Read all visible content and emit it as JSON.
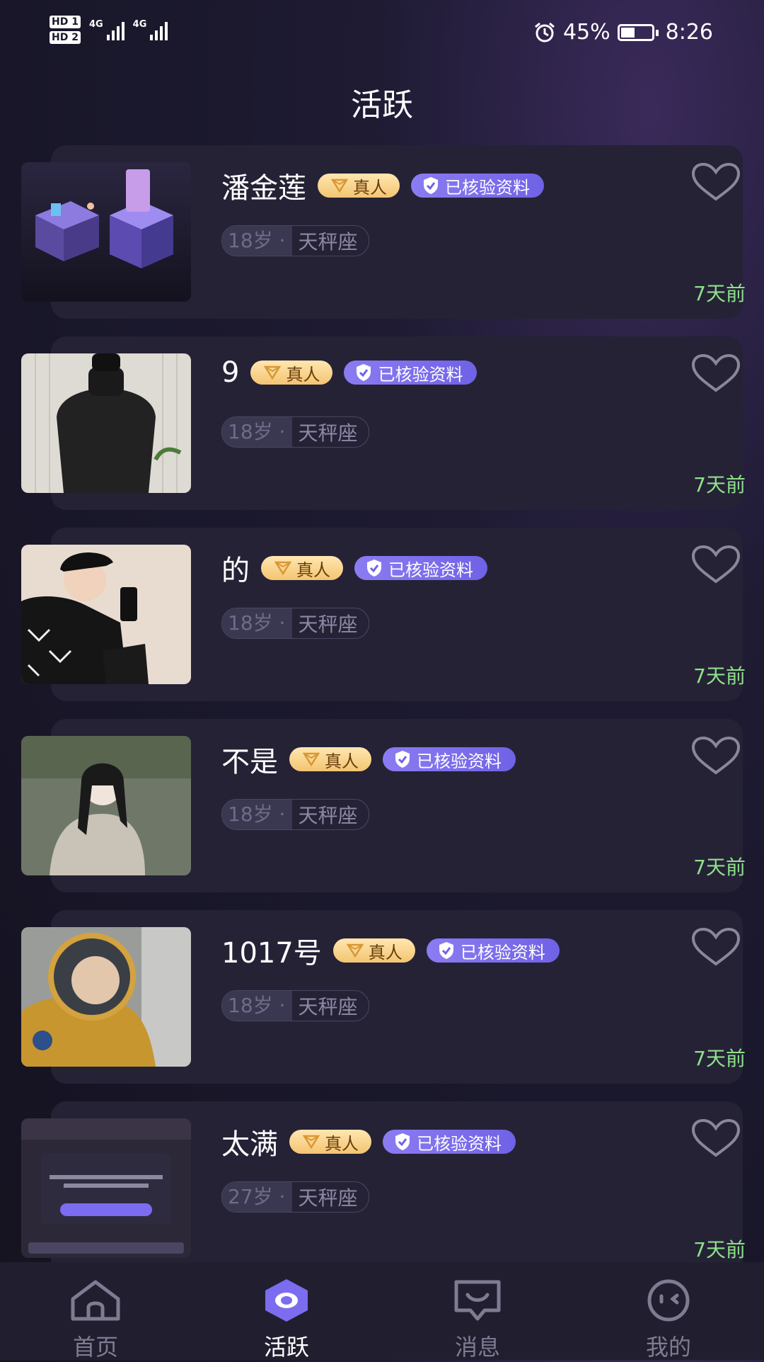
{
  "status_bar": {
    "sim1": "HD 1",
    "sim2": "HD 2",
    "network1": "4G",
    "network2": "4G",
    "battery": "45%",
    "battery_level": 0.45,
    "time": "8:26"
  },
  "page": {
    "title": "活跃"
  },
  "badges": {
    "real": "真人",
    "verified": "已核验资料"
  },
  "users": [
    {
      "name": "潘金莲",
      "age": "18岁 ·",
      "zodiac": "天秤座",
      "time": "7天前"
    },
    {
      "name": "9",
      "age": "18岁 ·",
      "zodiac": "天秤座",
      "time": "7天前"
    },
    {
      "name": "的",
      "age": "18岁 ·",
      "zodiac": "天秤座",
      "time": "7天前"
    },
    {
      "name": "不是",
      "age": "18岁 ·",
      "zodiac": "天秤座",
      "time": "7天前"
    },
    {
      "name": "1017号",
      "age": "18岁 ·",
      "zodiac": "天秤座",
      "time": "7天前"
    },
    {
      "name": "太满",
      "age": "27岁 ·",
      "zodiac": "天秤座",
      "time": "7天前"
    }
  ],
  "tabs": [
    {
      "label": "首页",
      "icon": "home-icon"
    },
    {
      "label": "活跃",
      "icon": "active-eye-icon",
      "active": true
    },
    {
      "label": "消息",
      "icon": "message-icon"
    },
    {
      "label": "我的",
      "icon": "profile-face-icon"
    }
  ],
  "colors": {
    "background": "#181628",
    "card": "#252236",
    "accent_purple": "#7b6cf0",
    "badge_gold": "#f3c572",
    "time_green": "#8ee08a"
  }
}
